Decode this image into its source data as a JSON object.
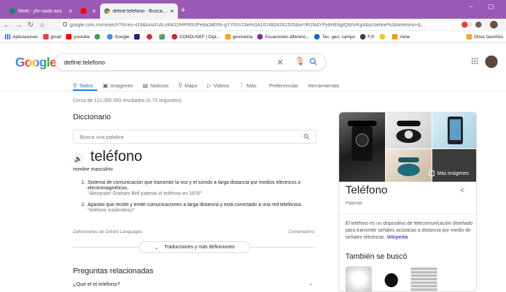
{
  "browser": {
    "tabs": [
      {
        "title": "Meet - yhr-uado-aou",
        "active": false
      },
      {
        "title": "",
        "active": false
      },
      {
        "title": "define:telefono - Buscar con Goo",
        "active": true
      }
    ],
    "new_tab": "+",
    "url": "google.com.mx/search?hl=es-419&sxsrf=ALeKk02tHPR0UPedaJ4EPA-gYY0Ur23w%3A1614824261520&ei=RUNAYPydH8SgtQWxrKg4&q=define%3Atelefono+&...",
    "bookmarks": [
      "Aplicaciones",
      "gmail",
      "youtube",
      "",
      "Google",
      "",
      "",
      "",
      "CONDUSEF | Dipl...",
      "geometria",
      "Ecuaciones diferenc...",
      "Tec. geo. campo",
      "F.P.",
      "",
      "mine"
    ],
    "other_bookmarks": "Otros favoritos"
  },
  "search": {
    "logo": "Google",
    "query": "define:telefono",
    "tabs": [
      {
        "label": "Todos",
        "icon": "search-icon",
        "glyph": "⚲"
      },
      {
        "label": "Imágenes",
        "icon": "image-icon",
        "glyph": "▣"
      },
      {
        "label": "Noticias",
        "icon": "news-icon",
        "glyph": "▤"
      },
      {
        "label": "Maps",
        "icon": "map-pin-icon",
        "glyph": "⚲"
      },
      {
        "label": "Videos",
        "icon": "video-icon",
        "glyph": "▷"
      },
      {
        "label": "Más",
        "icon": "more-icon",
        "glyph": "⋮"
      },
      {
        "label": "Preferencias",
        "icon": "",
        "glyph": ""
      },
      {
        "label": "Herramientas",
        "icon": "",
        "glyph": ""
      }
    ],
    "stats": "Cerca de 121,000,000 resultados (0.73 segundos)"
  },
  "dictionary": {
    "heading": "Diccionario",
    "search_placeholder": "Busca una palabra",
    "word": "teléfono",
    "part_of_speech": "nombre masculino",
    "definitions": [
      {
        "num": "1.",
        "text": "Sistema de comunicación que transmite la voz y el sonido a larga distancia por medios eléctricos o electromagnéticos.",
        "example": "\"Alexander Graham Bell patentó el teléfono en 1876\""
      },
      {
        "num": "2.",
        "text": "Aparato que recibe y emite comunicaciones a larga distancia y está conectado a una red telefónica.",
        "example": "\"teléfono inalámbrico\""
      }
    ],
    "source": "Definiciones de Oxford Languages",
    "feedback": "Comentarios",
    "more_button": "Traducciones y más definiciones"
  },
  "related": {
    "heading": "Preguntas relacionadas",
    "questions": [
      "¿Que el el teléfono?"
    ]
  },
  "knowledge_panel": {
    "more_images": "Más imágenes",
    "title": "Teléfono",
    "subtitle": "Patente",
    "description": "El teléfono es un dispositivo de telecomunicación diseñado para transmitir señales acústicas a distancia por medio de señales eléctricas.",
    "source_link": "Wikipedia",
    "also_searched": "También se buscó"
  },
  "colors": {
    "tabstrip": "#9b59b6",
    "accent": "#1a73e8",
    "link": "#1a0dab"
  }
}
